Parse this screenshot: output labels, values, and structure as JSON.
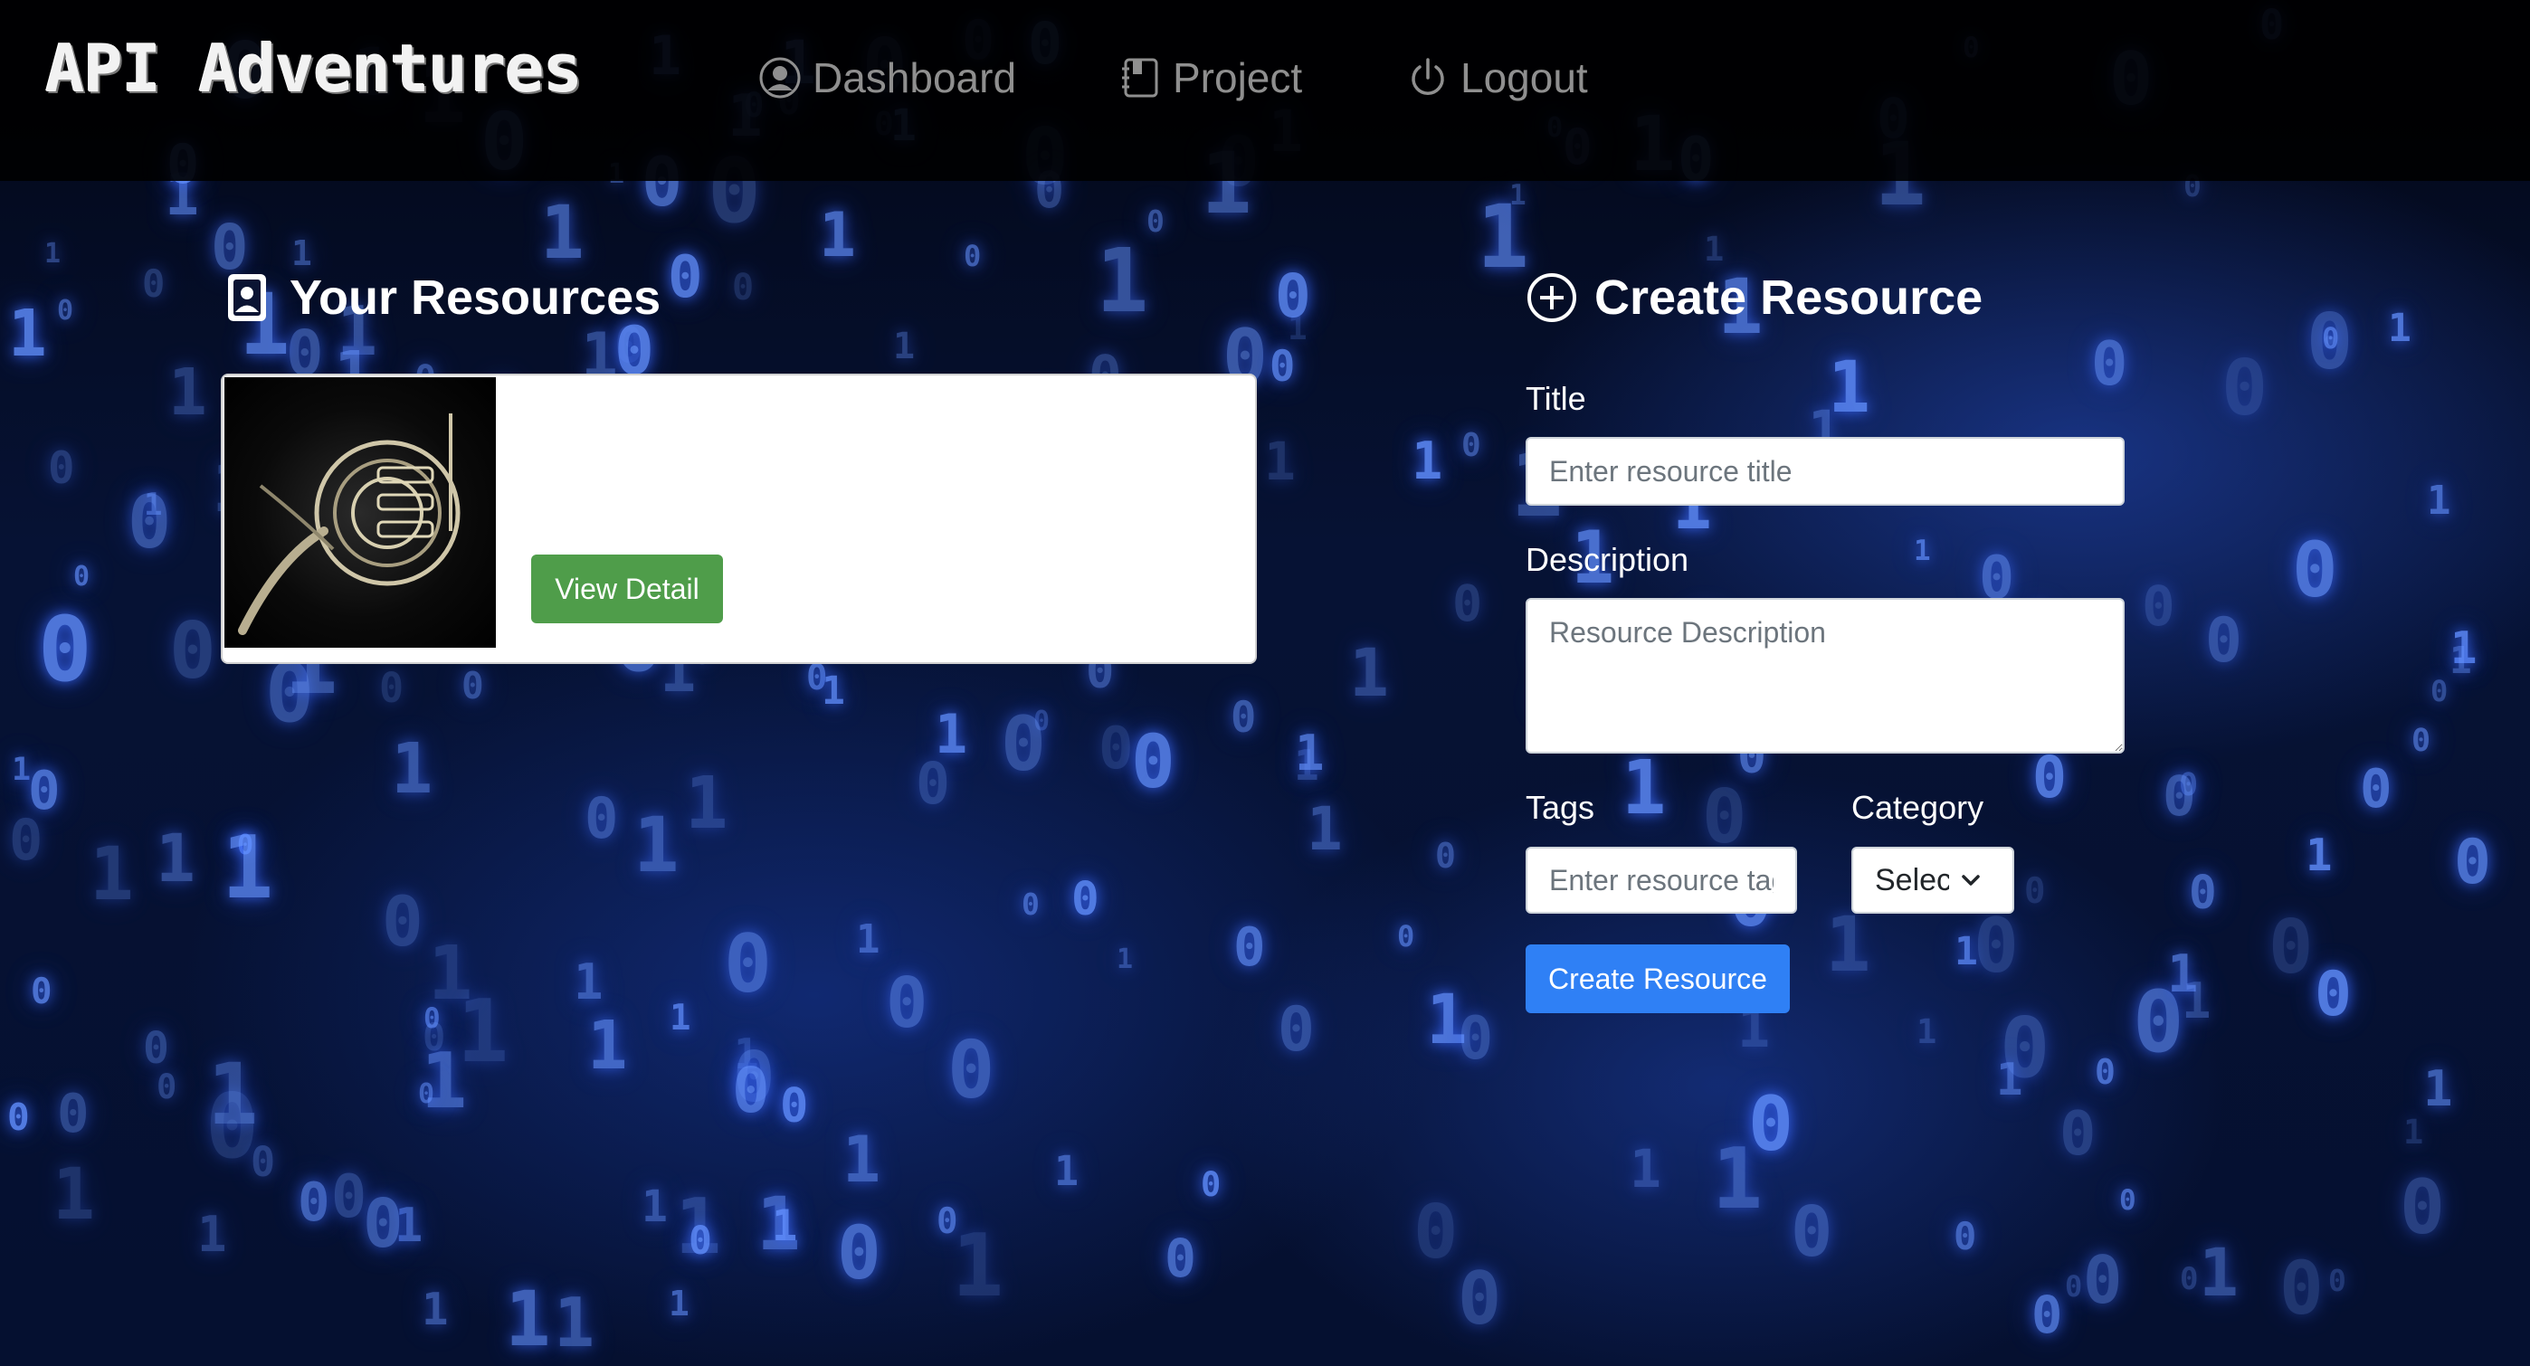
{
  "colors": {
    "navbar_bg": "#000000",
    "nav_link": "#8f8f8f",
    "view_detail_button": "#4f9d4a",
    "create_button": "#2f80f5",
    "background_glow": "#5f8dff"
  },
  "navbar": {
    "brand": "API Adventures",
    "links": [
      {
        "label": "Dashboard",
        "icon": "user-circle-icon"
      },
      {
        "label": "Project",
        "icon": "notebook-icon"
      },
      {
        "label": "Logout",
        "icon": "power-icon"
      }
    ]
  },
  "resources": {
    "title": "Your Resources",
    "icon": "person-badge-icon",
    "items": [
      {
        "image": "french-horn-image",
        "button_label": "View Detail"
      }
    ]
  },
  "create_form": {
    "title": "Create Resource",
    "icon": "plus-circle-icon",
    "title_label": "Title",
    "title_placeholder": "Enter resource title",
    "description_label": "Description",
    "description_placeholder": "Resource Description",
    "tags_label": "Tags",
    "tags_placeholder": "Enter resource tags",
    "category_label": "Category",
    "category_value": "Select",
    "submit_label": "Create Resource"
  }
}
